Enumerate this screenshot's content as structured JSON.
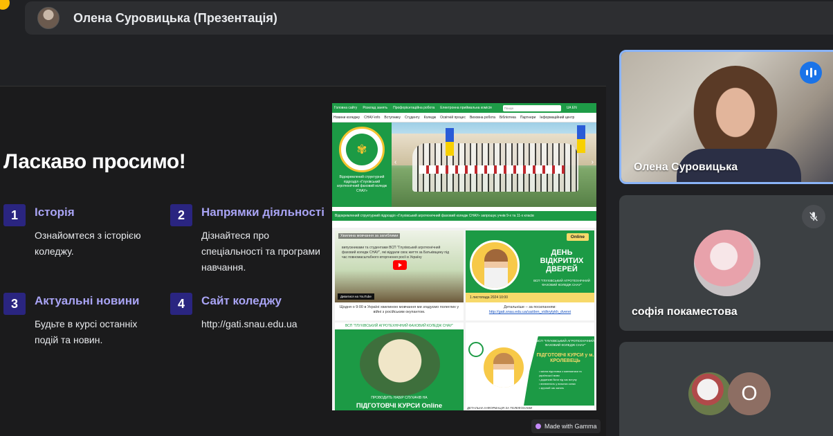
{
  "presenter": {
    "label": "Олена Суровицька (Презентація)"
  },
  "slide": {
    "title": "Ласкаво просимо!",
    "features": [
      {
        "num": "1",
        "title": "Історія",
        "desc": "Ознайомтеся з історією коледжу."
      },
      {
        "num": "2",
        "title": "Напрямки діяльності",
        "desc": "Дізнайтеся про спеціальності та програми навчання."
      },
      {
        "num": "3",
        "title": "Актуальні новини",
        "desc": "Будьте в курсі останніх подій та новин."
      },
      {
        "num": "4",
        "title": "Сайт коледжу",
        "desc": "http://gati.snau.edu.ua"
      }
    ],
    "badge": "Made with Gamma"
  },
  "site": {
    "topbar": [
      "Головна сайту",
      "Розклад занять",
      "Профорієнтаційна робота",
      "Електронна приймальна комісія"
    ],
    "search_placeholder": "Пошук",
    "lang": "UA EN",
    "nav": [
      "Новини коледжу",
      "СНАУ-info",
      "Вступнику",
      "Студенту",
      "Коледж",
      "Освітній процес",
      "Виховна робота",
      "Бібліотека",
      "Партнери",
      "Інформаційний центр"
    ],
    "hero_text": "Відокремлений структурний підрозділ «Глухівський агротехнічний фаховий коледж СНАУ»",
    "ticker": "Відокремлений структурний підрозділ «Глухівський агротехнічний фаховий коледж СНАУ» запрошує учнів 9-х та 11-х класів",
    "video": {
      "title": "Хвилина мовчання за загиблими",
      "body": "випускниками та студентами ВСП \"Глухівський агротехнічний фаховий коледж СНАУ\", які віддали своє життя за Батьківщину під час повномасштабного вторгнення росії в Україну",
      "watch": "Дивитися на YouTube",
      "caption": "Щодня о 9:00 в Україні хвилиною мовчання ми згадуємо полеглих у війні з російським окупантом."
    },
    "open_day": {
      "badge": "Online",
      "title": "ДЕНЬ ВІДКРИТИХ ДВЕРЕЙ",
      "sub": "ВСП \"ГЛУХІВСЬКИЙ АГРОТЕХНІЧНИЙ ФАХОВИЙ КОЛЕДЖ СНАУ\"",
      "date": "1 листопада 2024        10:00",
      "caption": "Детальніше – за посиланням:",
      "link": "http://gati.snau.edu.ua/ua/den_vidkrytykh_dverei"
    },
    "courses_left": {
      "head": "ВСП \"ГЛУХІВСЬКИЙ АГРОТЕХНІЧНИЙ ФАХОВИЙ КОЛЕДЖ СНАУ\"",
      "foot1": "ПРОВОДИТЬ НАБІР СЛУХАЧІВ НА",
      "foot2": "ПІДГОТОВЧІ КУРСИ Online"
    },
    "courses_right": {
      "t1": "ВСП \"ГЛУХІВСЬКИЙ АГРОТЕХНІЧНИЙ ФАХОВИЙ КОЛЕДЖ СНАУ\"",
      "t2": "ПІДГОТОВЧІ КУРСИ у м. КРОЛЕВЕЦЬ",
      "list": "• якісна підготовка з математики та української мови\n• додаткові бали під час вступу\n• впевненість у власних силах\n• зручний час занять",
      "foot": "ДЕТАЛЬНА ІНФОРМАЦІЯ ЗА ТЕЛЕФОНАМИ"
    }
  },
  "participants": [
    {
      "name": "Олена Суровицька",
      "speaking": true
    },
    {
      "name": "софія покаместова",
      "muted": true
    },
    {
      "letter": "О"
    }
  ],
  "colors": {
    "speaking_border": "#8ab4f8",
    "speaking_badge": "#1a73e8",
    "feature_number_bg": "#2a2580",
    "feature_title": "#a9a4f5",
    "site_green": "#1c9a45"
  },
  "icons": {
    "speaking": "audio-bars-icon",
    "muted": "mic-off-icon",
    "gamma": "gamma-logo-icon"
  }
}
